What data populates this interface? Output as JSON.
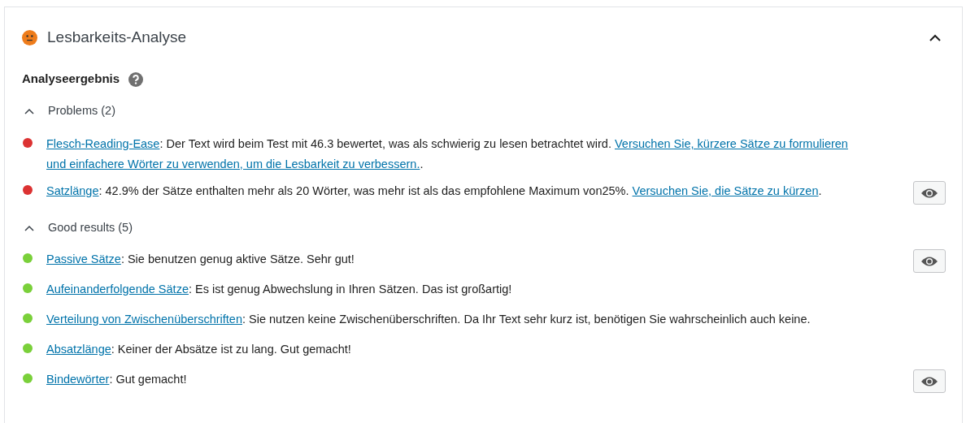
{
  "panel": {
    "title": "Lesbarkeits-Analyse",
    "expanded": true
  },
  "heading": "Analyseergebnis",
  "groups": [
    {
      "label": "Problems (2)",
      "expanded": true,
      "results": [
        {
          "color": "#dc3232",
          "has_marker": false,
          "parts": [
            {
              "kind": "link",
              "text": "Flesch-Reading-Ease"
            },
            {
              "kind": "text",
              "text": ": Der Text wird beim Test mit 46.3 bewertet, was als schwierig zu lesen betrachtet wird. "
            },
            {
              "kind": "link",
              "text": "Versuchen Sie, kürzere Sätze zu formulieren"
            },
            {
              "kind": "link",
              "text": "und einfachere Wörter zu verwenden, um die Lesbarkeit zu verbessern."
            },
            {
              "kind": "text",
              "text": "."
            }
          ]
        },
        {
          "color": "#dc3232",
          "has_marker": true,
          "parts": [
            {
              "kind": "link",
              "text": "Satzlänge"
            },
            {
              "kind": "text",
              "text": ": 42.9% der Sätze enthalten mehr als 20 Wörter, was mehr ist als das empfohlene Maximum von25%. "
            },
            {
              "kind": "link",
              "text": "Versuchen Sie, die Sätze zu kürzen"
            },
            {
              "kind": "text",
              "text": "."
            }
          ]
        }
      ]
    },
    {
      "label": "Good results (5)",
      "expanded": true,
      "results": [
        {
          "color": "#7ad03a",
          "has_marker": true,
          "parts": [
            {
              "kind": "link",
              "text": "Passive Sätze"
            },
            {
              "kind": "text",
              "text": ": Sie benutzen genug aktive Sätze. Sehr gut!"
            }
          ]
        },
        {
          "color": "#7ad03a",
          "has_marker": false,
          "parts": [
            {
              "kind": "link",
              "text": "Aufeinanderfolgende Sätze"
            },
            {
              "kind": "text",
              "text": ": Es ist genug Abwechslung in Ihren Sätzen. Das ist großartig!"
            }
          ]
        },
        {
          "color": "#7ad03a",
          "has_marker": false,
          "parts": [
            {
              "kind": "link",
              "text": "Verteilung von Zwischenüberschriften"
            },
            {
              "kind": "text",
              "text": ": Sie nutzen keine Zwischenüberschriften. Da Ihr Text sehr kurz ist, benötigen Sie wahrscheinlich auch keine."
            }
          ]
        },
        {
          "color": "#7ad03a",
          "has_marker": false,
          "parts": [
            {
              "kind": "link",
              "text": "Absatzlänge"
            },
            {
              "kind": "text",
              "text": ": Keiner der Absätze ist zu lang. Gut gemacht!"
            }
          ]
        },
        {
          "color": "#7ad03a",
          "has_marker": true,
          "parts": [
            {
              "kind": "link",
              "text": "Bindewörter"
            },
            {
              "kind": "text",
              "text": ": Gut gemacht!"
            }
          ]
        }
      ]
    }
  ]
}
